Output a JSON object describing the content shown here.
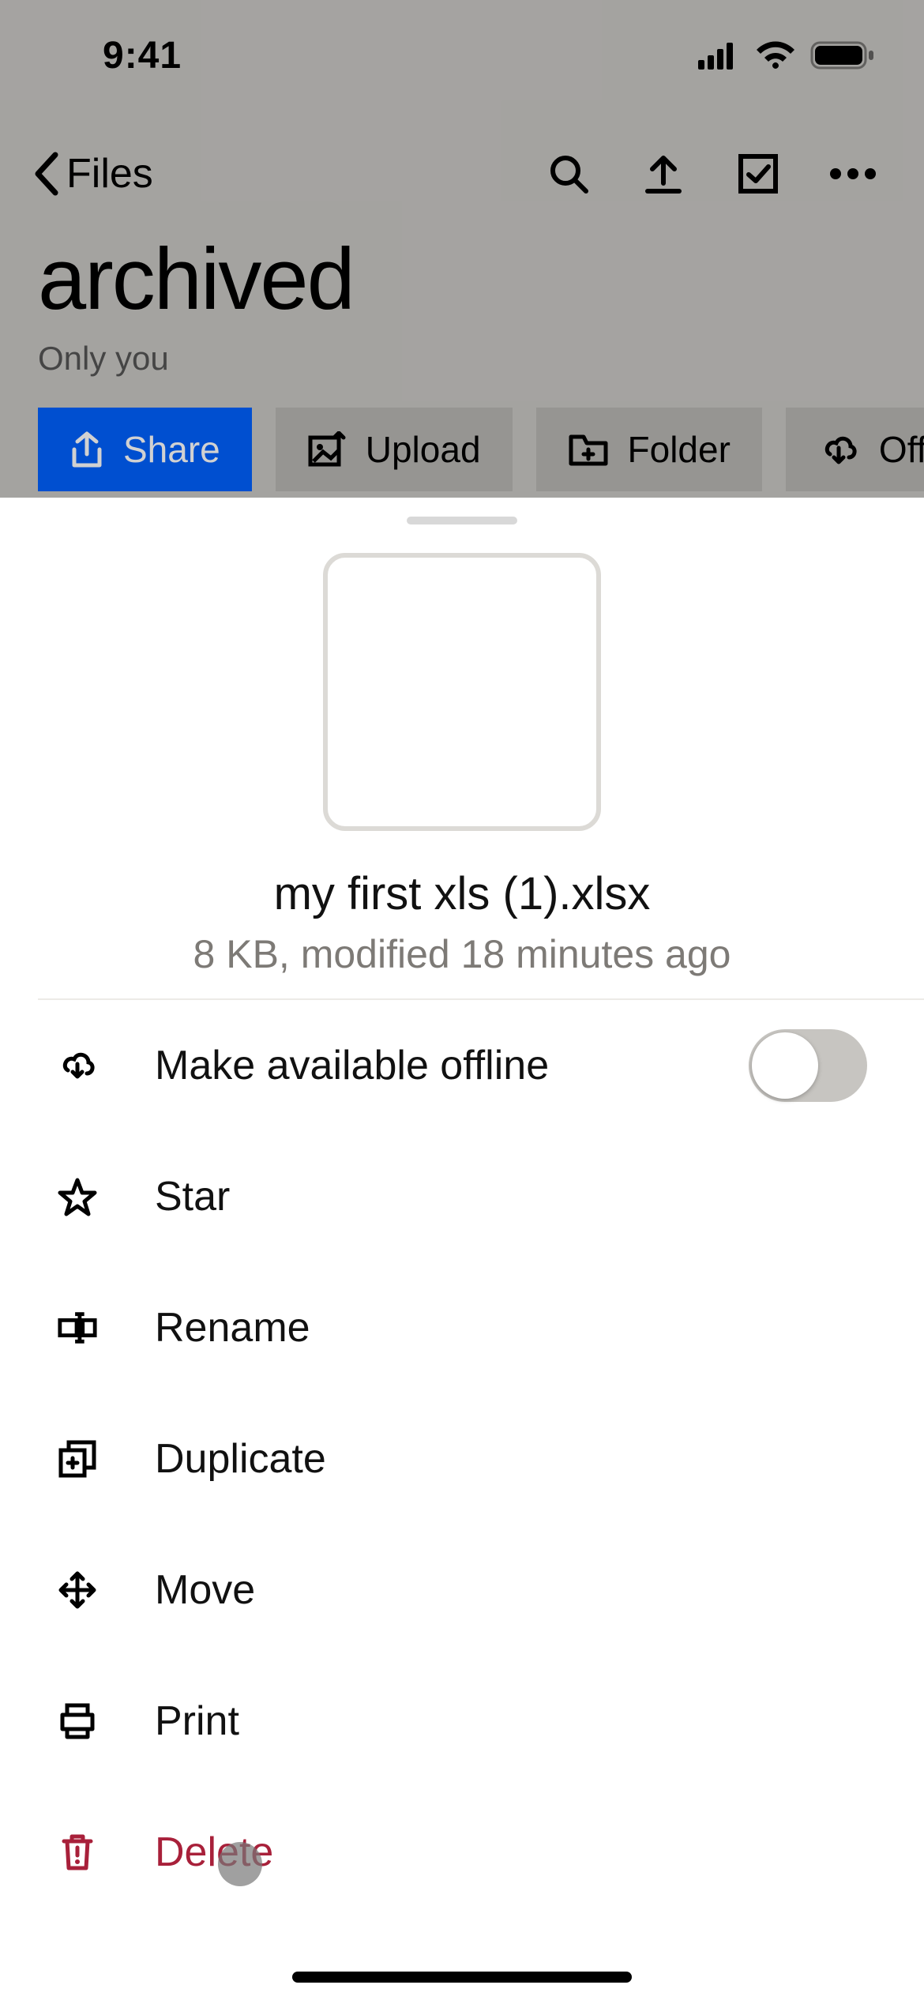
{
  "status": {
    "time": "9:41"
  },
  "nav": {
    "back_label": "Files"
  },
  "folder": {
    "title": "archived",
    "subtitle": "Only you"
  },
  "chips": {
    "share": "Share",
    "upload": "Upload",
    "folder": "Folder",
    "offline": "Offline"
  },
  "sheet": {
    "file_name": "my first xls (1).xlsx",
    "file_meta": "8 KB, modified 18 minutes ago",
    "actions": {
      "offline": "Make available offline",
      "star": "Star",
      "rename": "Rename",
      "duplicate": "Duplicate",
      "move": "Move",
      "print": "Print",
      "delete": "Delete"
    },
    "offline_toggle": false
  }
}
